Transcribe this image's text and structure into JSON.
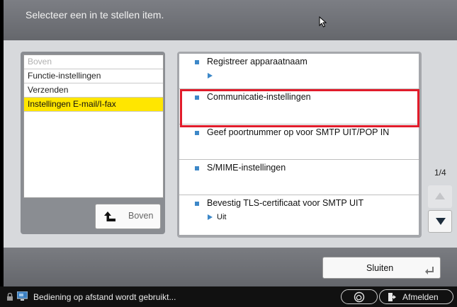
{
  "header": {
    "prompt": "Selecteer een in te stellen item."
  },
  "left_list": {
    "items": [
      {
        "label": "Boven",
        "state": "dim"
      },
      {
        "label": "Functie-instellingen",
        "state": "normal"
      },
      {
        "label": "Verzenden",
        "state": "normal"
      },
      {
        "label": "Instellingen E-mail/I-fax",
        "state": "selected"
      }
    ],
    "up_button_label": "Boven"
  },
  "right_list": {
    "items": [
      {
        "title": "Registreer apparaatnaam",
        "sub": ""
      },
      {
        "title": "Communicatie-instellingen",
        "sub": ""
      },
      {
        "title": "Geef poortnummer op voor SMTP UIT/POP IN",
        "sub": ""
      },
      {
        "title": "S/MIME-instellingen",
        "sub": ""
      },
      {
        "title": "Bevestig TLS-certificaat voor SMTP UIT",
        "sub": "Uit"
      }
    ],
    "highlighted_item": "Communicatie-instellingen"
  },
  "pagination": {
    "indicator": "1/4"
  },
  "footer": {
    "close_label": "Sluiten"
  },
  "status_bar": {
    "message": "Bediening op afstand wordt gebruikt...",
    "logout_label": "Afmelden"
  },
  "colors": {
    "selected_bg": "#ffe600",
    "highlight_border": "#e11b2a",
    "bullet": "#3d88c8"
  },
  "icons": [
    "cursor-icon",
    "up-arrow-icon",
    "scroll-up-icon",
    "scroll-down-icon",
    "enter-icon",
    "lock-icon",
    "monitor-icon",
    "remote-icon",
    "logout-icon"
  ]
}
